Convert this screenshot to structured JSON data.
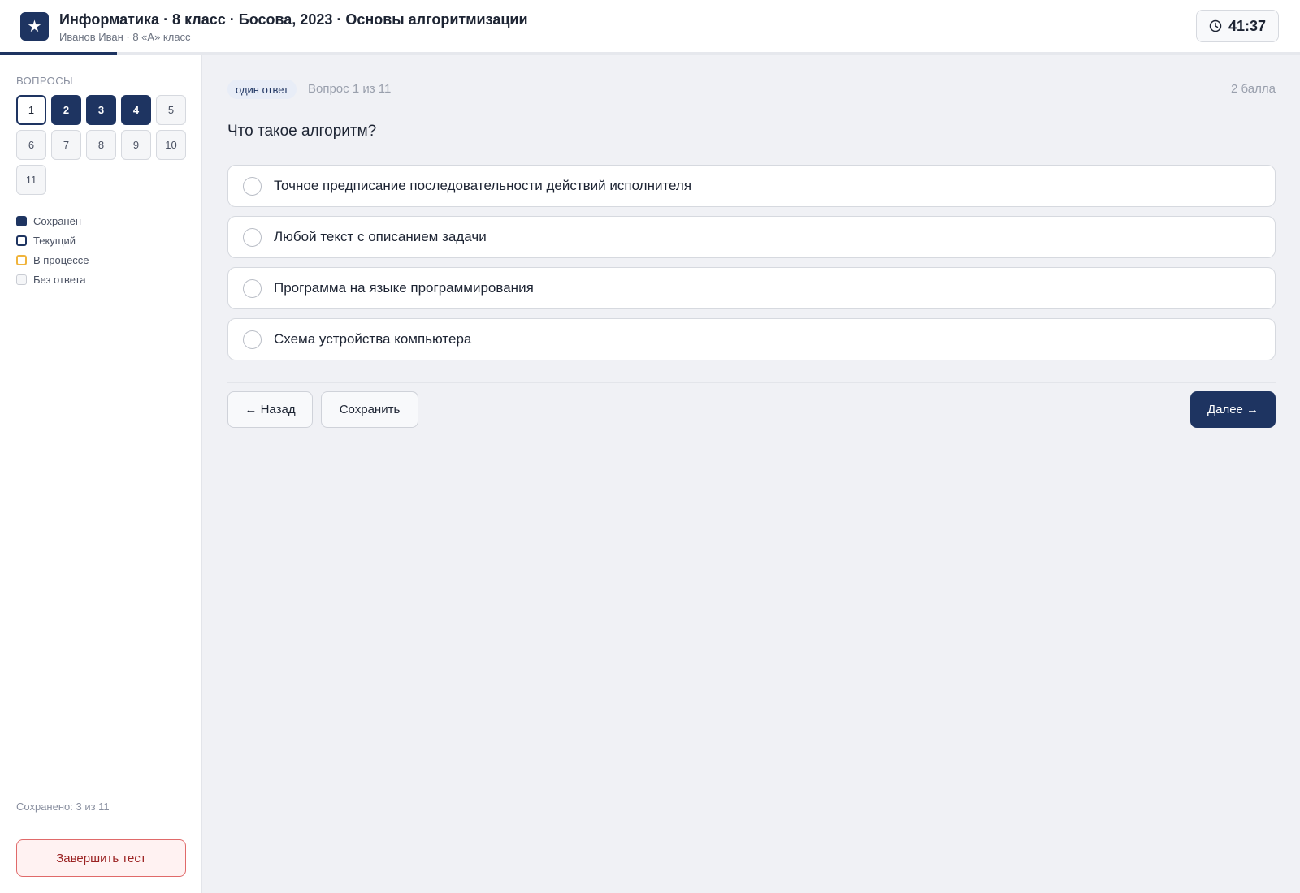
{
  "header": {
    "logo_icon": "star-icon",
    "title": "Информатика · 8 класс · Босова, 2023 · Основы алгоритмизации",
    "subtitle": "Иванов Иван · 8 «А» класс",
    "timer_icon": "clock-icon",
    "timer": "41:37",
    "progress_fraction": 0.09
  },
  "sidebar": {
    "title": "ВОПРОСЫ",
    "questions": [
      {
        "label": "1",
        "state": "current"
      },
      {
        "label": "2",
        "state": "saved"
      },
      {
        "label": "3",
        "state": "saved"
      },
      {
        "label": "4",
        "state": "saved"
      },
      {
        "label": "5",
        "state": "none"
      },
      {
        "label": "6",
        "state": "none"
      },
      {
        "label": "7",
        "state": "none"
      },
      {
        "label": "8",
        "state": "none"
      },
      {
        "label": "9",
        "state": "none"
      },
      {
        "label": "10",
        "state": "none"
      },
      {
        "label": "11",
        "state": "none"
      }
    ],
    "legend": [
      {
        "label": "Сохранён",
        "state": "saved"
      },
      {
        "label": "Текущий",
        "state": "current"
      },
      {
        "label": "В процессе",
        "state": "progress"
      },
      {
        "label": "Без ответа",
        "state": "none"
      }
    ],
    "saved_count": "Сохранено: 3 из 11",
    "finish_label": "Завершить тест"
  },
  "main": {
    "badge": "один ответ",
    "question_number": "Вопрос 1 из 11",
    "points": "2 балла",
    "question": "Что такое алгоритм?",
    "options": [
      "Точное предписание последовательности действий исполнителя",
      "Любой текст с описанием задачи",
      "Программа на языке программирования",
      "Схема устройства компьютера"
    ],
    "back_label": "← Назад",
    "save_label": "Сохранить",
    "next_label": "Далее →"
  },
  "colors": {
    "accent": "#1e3461",
    "in_progress": "#f0b43c",
    "danger": "#e06a6a"
  }
}
